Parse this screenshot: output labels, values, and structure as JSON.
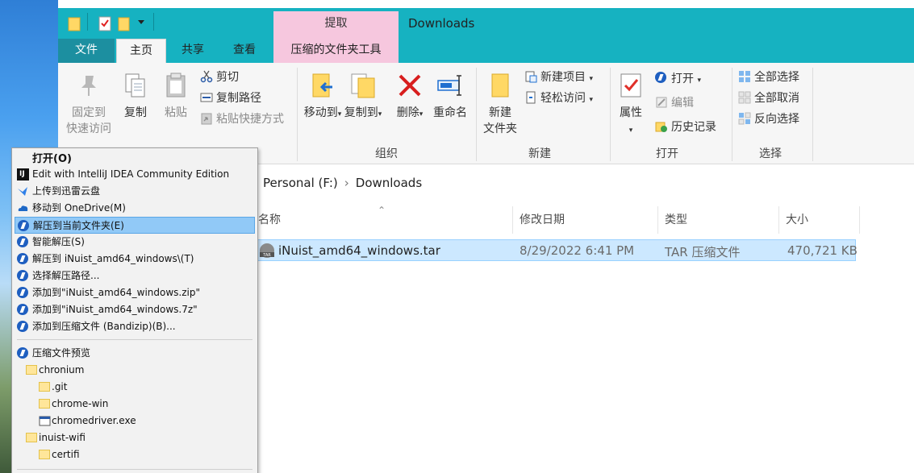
{
  "window": {
    "title": "Downloads"
  },
  "contextual_tab": {
    "label": "提取"
  },
  "tabs": [
    {
      "label": "文件"
    },
    {
      "label": "主页"
    },
    {
      "label": "共享"
    },
    {
      "label": "查看"
    },
    {
      "label": "压缩的文件夹工具"
    }
  ],
  "ribbon": {
    "clipboard": {
      "pin_line1": "固定到",
      "pin_line2": "快速访问",
      "copy": "复制",
      "paste": "粘贴",
      "cut": "剪切",
      "copy_path": "复制路径",
      "paste_shortcut": "粘贴快捷方式"
    },
    "organize": {
      "move_to": "移动到",
      "copy_to": "复制到",
      "delete": "删除",
      "rename": "重命名",
      "label": "组织"
    },
    "new": {
      "new_folder_line1": "新建",
      "new_folder_line2": "文件夹",
      "new_item": "新建项目",
      "easy_access": "轻松访问",
      "label": "新建"
    },
    "open": {
      "properties": "属性",
      "open": "打开",
      "edit": "编辑",
      "history": "历史记录",
      "label": "打开"
    },
    "select": {
      "select_all": "全部选择",
      "select_none": "全部取消",
      "invert": "反向选择",
      "label": "选择"
    }
  },
  "address": {
    "crumbs": [
      "Personal (F:)",
      "Downloads"
    ]
  },
  "columns": {
    "name": "名称",
    "date": "修改日期",
    "type": "类型",
    "size": "大小"
  },
  "files": [
    {
      "name": "iNuist_amd64_windows.tar",
      "date": "8/29/2022 6:41 PM",
      "type": "TAR 压缩文件",
      "size": "470,721 KB"
    }
  ],
  "context_menu": {
    "items": [
      {
        "label": "打开(O)"
      },
      {
        "label": "Edit with IntelliJ IDEA Community Edition"
      },
      {
        "label": "上传到迅雷云盘"
      },
      {
        "label": "移动到 OneDrive(M)"
      },
      {
        "label": "解压到当前文件夹(E)"
      },
      {
        "label": "智能解压(S)"
      },
      {
        "label": "解压到 iNuist_amd64_windows\\(T)"
      },
      {
        "label": "选择解压路径..."
      },
      {
        "label": "添加到\"iNuist_amd64_windows.zip\""
      },
      {
        "label": "添加到\"iNuist_amd64_windows.7z\""
      },
      {
        "label": "添加到压缩文件 (Bandizip)(B)..."
      }
    ],
    "preview": {
      "label": "压缩文件预览",
      "tree": [
        {
          "label": "chronium"
        },
        {
          "label": ".git"
        },
        {
          "label": "chrome-win"
        },
        {
          "label": "chromedriver.exe"
        },
        {
          "label": "inuist-wifi"
        },
        {
          "label": "certifi"
        }
      ]
    }
  },
  "colors": {
    "titlebar": "#16b2c1",
    "contextual_tab": "#f6c7de",
    "selection": "#cce8ff",
    "menu_highlight": "#91c9f7"
  }
}
